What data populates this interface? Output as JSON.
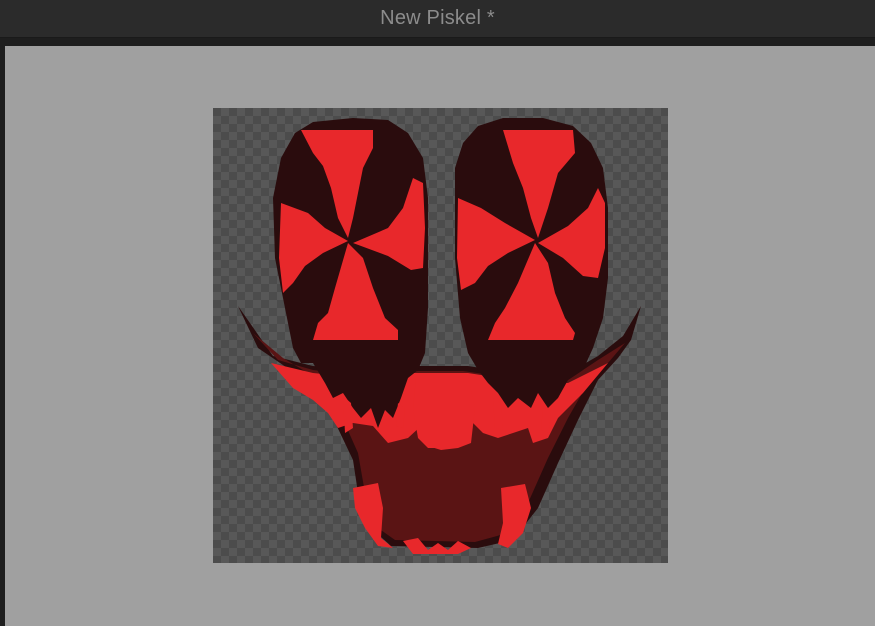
{
  "window": {
    "title": "New Piskel *"
  },
  "canvas": {
    "drawing": "skull-face-pixel-art",
    "colors": {
      "bright_red": "#e8282b",
      "dark_maroon": "#2a0c0d",
      "mouth_red": "#5a1414",
      "transparent_light": "#585858",
      "transparent_dark": "#4c4c4c"
    }
  }
}
